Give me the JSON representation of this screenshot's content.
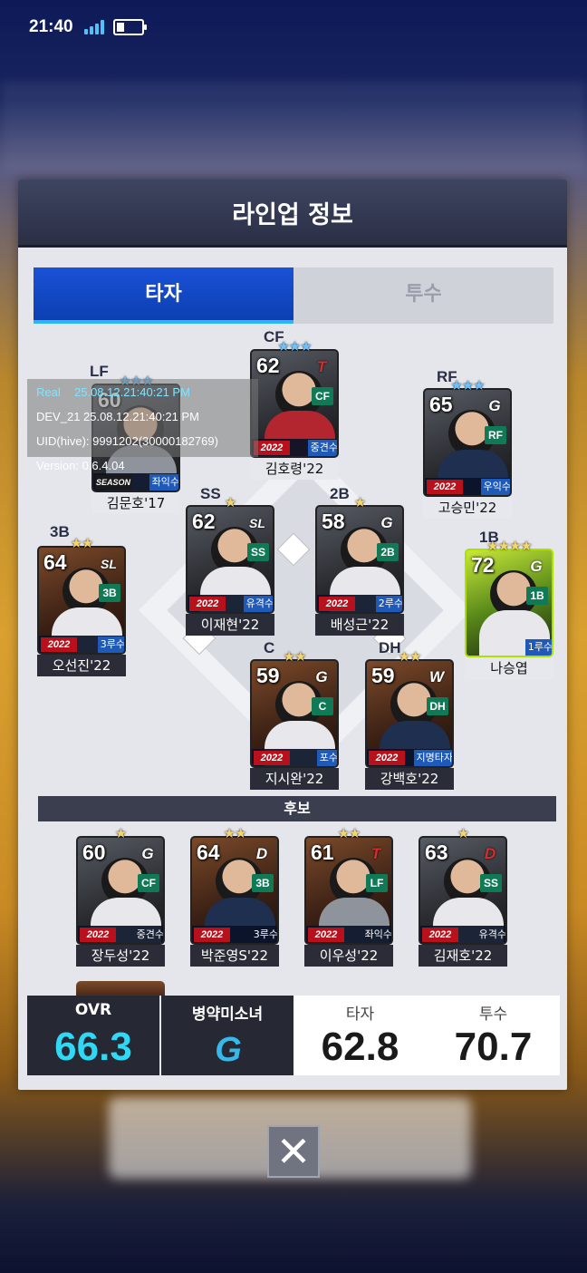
{
  "status_bar": {
    "time": "21:40"
  },
  "modal": {
    "title": "라인업 정보"
  },
  "tabs": [
    {
      "label": "타자"
    },
    {
      "label": "투수"
    }
  ],
  "positions": {
    "lf": "LF",
    "cf": "CF",
    "rf": "RF",
    "ss": "SS",
    "b2": "2B",
    "b3": "3B",
    "b1": "1B",
    "c": "C",
    "dh": "DH"
  },
  "lineup": {
    "lf": {
      "ovr": "60",
      "stars": "★★★",
      "pos": "",
      "season": "SEASON",
      "role": "좌익수",
      "name": "김문호'17"
    },
    "cf": {
      "ovr": "62",
      "stars": "★★★",
      "team": "T",
      "pos": "CF",
      "season": "2022 V3",
      "role": "중견수",
      "name": "김호령'22"
    },
    "rf": {
      "ovr": "65",
      "stars": "★★★",
      "team": "G",
      "pos": "RF",
      "season": "2022 V3",
      "role": "우익수",
      "name": "고승민'22"
    },
    "ss": {
      "ovr": "62",
      "stars": "★",
      "team": "SL",
      "pos": "SS",
      "season": "2022 V3",
      "role": "유격수",
      "name": "이재현'22"
    },
    "b2": {
      "ovr": "58",
      "stars": "★",
      "team": "G",
      "pos": "2B",
      "season": "2022 V3",
      "role": "2루수",
      "name": "배성근'22"
    },
    "b3": {
      "ovr": "64",
      "stars": "★★",
      "team": "SL",
      "pos": "3B",
      "season": "2022 V3",
      "role": "3루수",
      "name": "오선진'22"
    },
    "b1": {
      "ovr": "72",
      "stars": "★★★★",
      "team": "G",
      "pos": "1B",
      "season": "",
      "role": "1루수",
      "name": "나승엽"
    },
    "c": {
      "ovr": "59",
      "stars": "★★",
      "team": "G",
      "pos": "C",
      "season": "2022 V3",
      "role": "포수",
      "name": "지시완'22"
    },
    "dh": {
      "ovr": "59",
      "stars": "★★",
      "team": "W",
      "pos": "DH",
      "season": "2022 V3",
      "role": "지명타자",
      "name": "강백호'22"
    }
  },
  "bench_title": "후보",
  "bench": [
    {
      "ovr": "60",
      "stars": "★",
      "team": "G",
      "pos": "CF",
      "season": "2022 V3",
      "role": "중견수",
      "name": "장두성'22"
    },
    {
      "ovr": "64",
      "stars": "★★",
      "team": "D",
      "pos": "3B",
      "season": "2022 V3",
      "role": "3루수",
      "name": "박준영S'22"
    },
    {
      "ovr": "61",
      "stars": "★★",
      "team": "T",
      "pos": "LF",
      "season": "2022 V3",
      "role": "좌익수",
      "name": "이우성'22"
    },
    {
      "ovr": "63",
      "stars": "★",
      "team": "D",
      "pos": "SS",
      "season": "2022 V3",
      "role": "유격수",
      "name": "김재호'22"
    }
  ],
  "summary": {
    "ovr_label": "OVR",
    "ovr_value": "66.3",
    "team_name": "병약미소녀",
    "team_logo": "G",
    "batter_label": "타자",
    "batter_value": "62.8",
    "pitcher_label": "투수",
    "pitcher_value": "70.7"
  },
  "debug": {
    "real": "Real",
    "dev": "DEV_21",
    "overlay": "25.08.12.21:40:21 PM",
    "uid": "UID(hive): 9991202(30000182769)",
    "version": "Version: 0.6.4.04"
  },
  "close_glyph": "✕",
  "colors": {
    "accent_tab": "#0c3fb2",
    "ovr_value": "#2fd8f5",
    "team_logo": "#35b8ea",
    "position_badge": "#0f7a55",
    "season_badge": "#b8111c"
  }
}
